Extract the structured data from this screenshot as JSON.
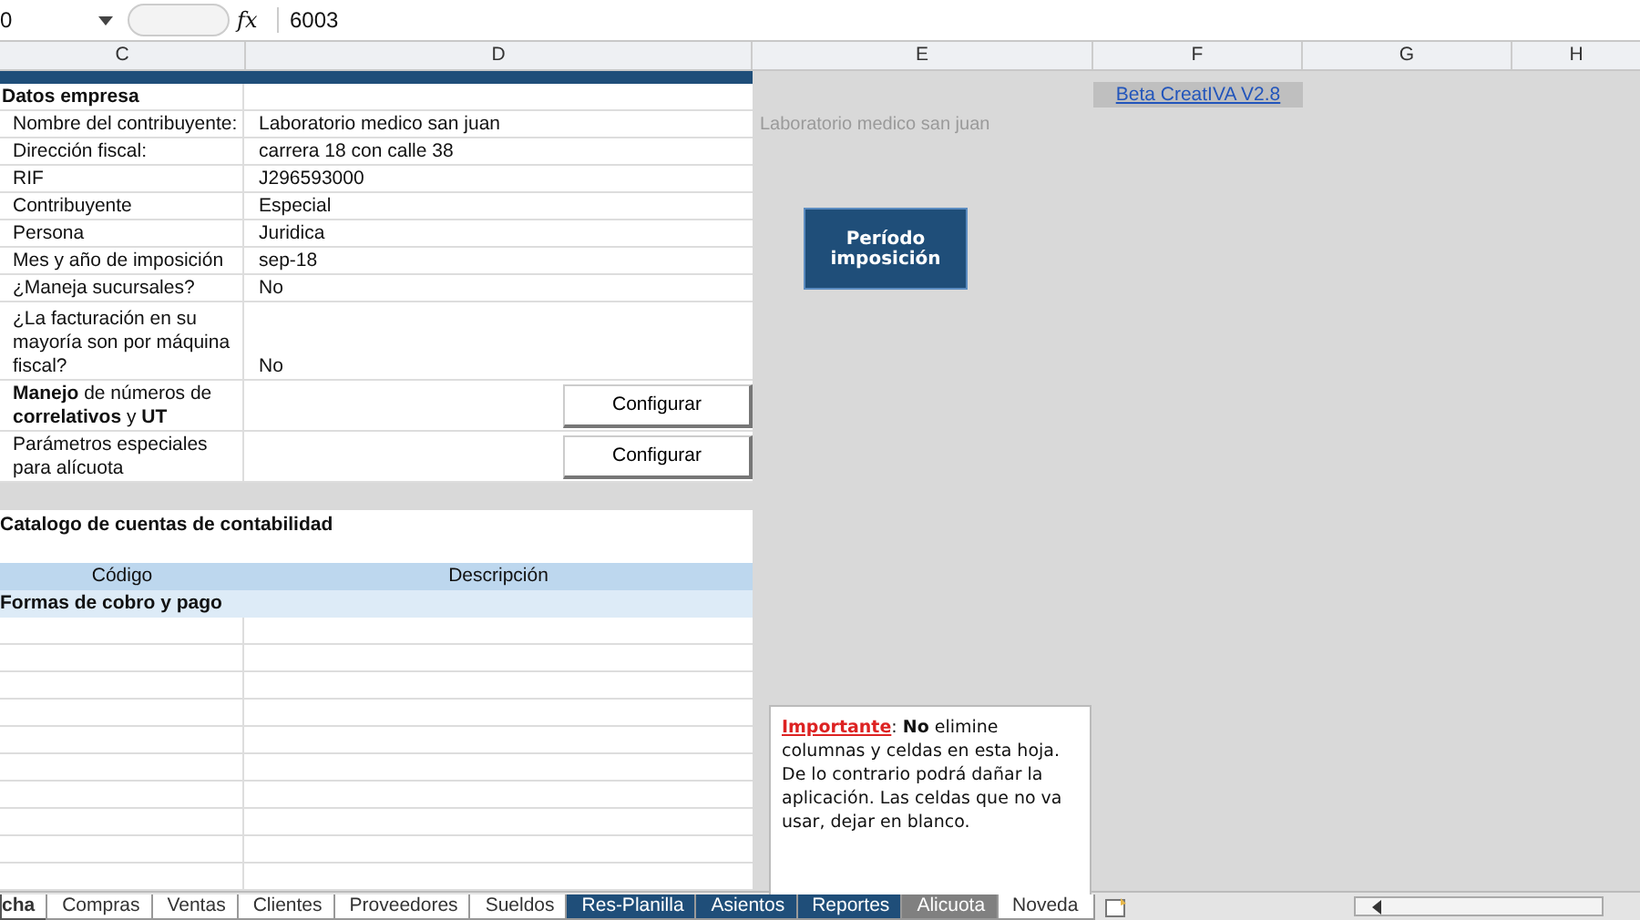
{
  "formula_bar": {
    "name_box": "0",
    "function_symbol": "fx",
    "value": "6003"
  },
  "columns": [
    "C",
    "D",
    "E",
    "F",
    "G",
    "H"
  ],
  "company": {
    "title": "Datos empresa",
    "fields": [
      {
        "label": "Nombre del contribuyente:",
        "value": "Laboratorio medico san juan",
        "kind": "text"
      },
      {
        "label": "Dirección fiscal:",
        "value": "carrera 18 con calle 38",
        "kind": "text"
      },
      {
        "label": "RIF",
        "value": "J296593000",
        "kind": "text"
      },
      {
        "label": "Contribuyente",
        "value": "Especial",
        "kind": "text"
      },
      {
        "label": "Persona",
        "value": "Juridica",
        "kind": "text"
      },
      {
        "label": "Mes y año de imposición",
        "value": "sep-18",
        "kind": "text"
      },
      {
        "label": "¿Maneja sucursales?",
        "value": "No",
        "kind": "text"
      },
      {
        "label": "¿La facturación en su mayoría son por máquina fiscal?",
        "value": "No",
        "kind": "tall"
      },
      {
        "label": "**Manejo** de números de **correlativos** y **UT**",
        "button": "Configurar",
        "kind": "button"
      },
      {
        "label": "Parámetros especiales para alícuota",
        "button": "Configurar",
        "kind": "button"
      }
    ]
  },
  "catalog": {
    "title": "Catalogo de cuentas de contabilidad",
    "columns": [
      "Código",
      "Descripción"
    ],
    "group": "Formas de cobro y pago"
  },
  "overlay": {
    "link": "Beta CreatIVA V2.8",
    "faded_text": "Laboratorio medico san juan",
    "period_button": "Período imposición",
    "note": {
      "label": "Importante",
      "text": ": **No** elimine columnas y celdas en esta hoja. De lo contrario podrá dañar la aplicación. Las celdas que no va usar, dejar en blanco."
    }
  },
  "sheet_tabs": [
    {
      "label": "cha",
      "selected": true,
      "color": "#ffffff"
    },
    {
      "label": "Compras",
      "selected": false,
      "color": "#ffffff"
    },
    {
      "label": "Ventas",
      "selected": false,
      "color": "#ffffff"
    },
    {
      "label": "Clientes",
      "selected": false,
      "color": "#ffffff"
    },
    {
      "label": "Proveedores",
      "selected": false,
      "color": "#ffffff"
    },
    {
      "label": "Sueldos",
      "selected": false,
      "color": "#ffffff"
    },
    {
      "label": "Res-Planilla",
      "selected": false,
      "color": "#1f4e79"
    },
    {
      "label": "Asientos",
      "selected": false,
      "color": "#1f4e79"
    },
    {
      "label": "Reportes",
      "selected": false,
      "color": "#1f4e79"
    },
    {
      "label": "Alicuota",
      "selected": false,
      "color": "#808080"
    },
    {
      "label": "Noveda",
      "selected": false,
      "color": "#ffffff"
    }
  ]
}
